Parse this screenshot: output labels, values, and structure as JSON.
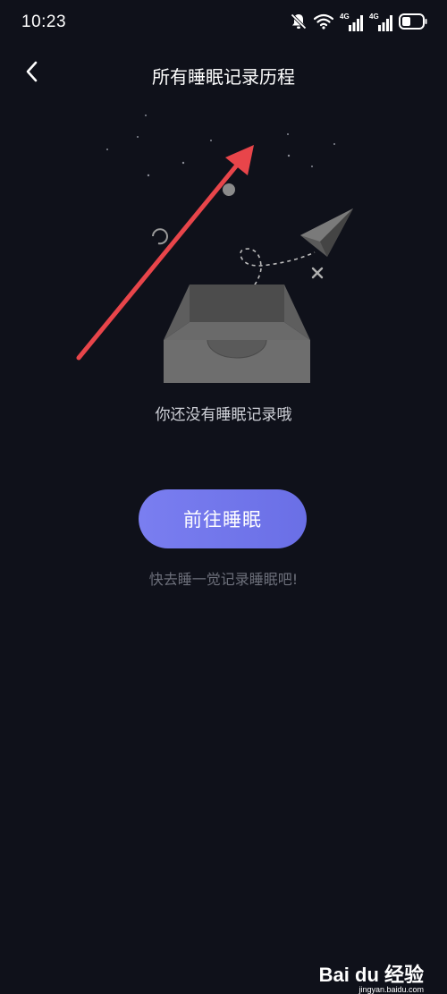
{
  "status_bar": {
    "time": "10:23",
    "icons": [
      "mute-bell-icon",
      "wifi-icon",
      "signal-4g-icon",
      "signal-4g-icon",
      "battery-icon"
    ],
    "network_label_1": "4G",
    "network_label_2": "4G"
  },
  "nav": {
    "back_icon": "chevron-left-icon",
    "title": "所有睡眠记录历程"
  },
  "empty_state": {
    "illustration": "empty-tray-with-paper-plane",
    "message": "你还没有睡眠记录哦"
  },
  "action": {
    "button_label": "前往睡眠",
    "hint": "快去睡一觉记录睡眠吧!"
  },
  "annotation": {
    "arrow_color": "#e8454a",
    "arrow_icon": "red-arrow-icon"
  },
  "watermark": {
    "logo": "Bai du 经验",
    "url": "jingyan.baidu.com"
  },
  "colors": {
    "background": "#0f111a",
    "button_gradient_start": "#7a7ef0",
    "button_gradient_end": "#6a6fe6",
    "tray": "#6e6e6e"
  }
}
